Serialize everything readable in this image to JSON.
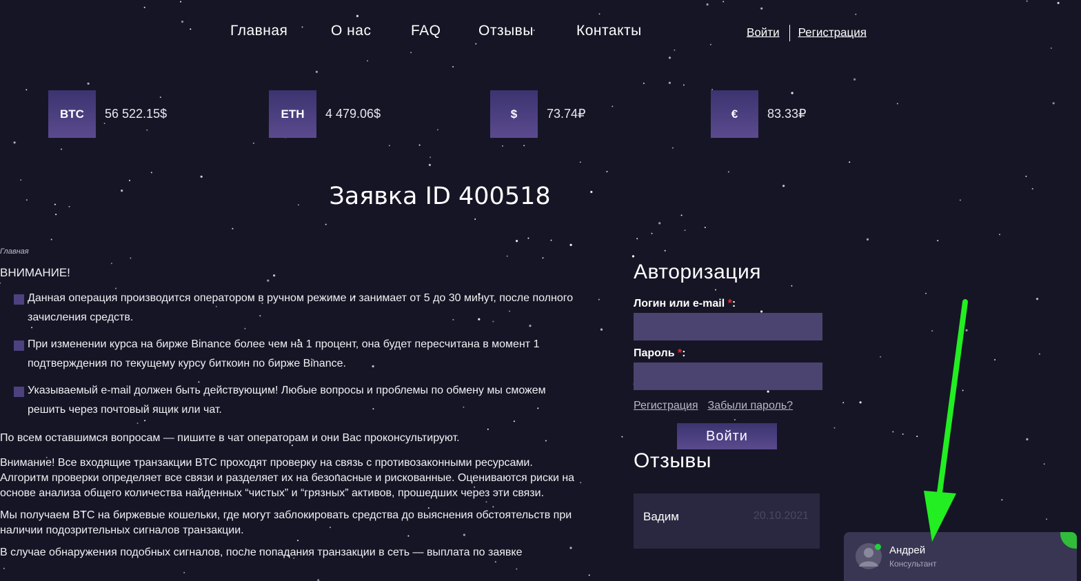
{
  "nav": {
    "items": [
      "Главная",
      "О нас",
      "FAQ",
      "Отзывы",
      "Контакты"
    ],
    "login": "Войти",
    "register": "Регистрация"
  },
  "rates": [
    {
      "symbol": "BTC",
      "value": "56 522.15$"
    },
    {
      "symbol": "ETH",
      "value": "4 479.06$"
    },
    {
      "symbol": "$",
      "value": "73.74₽"
    },
    {
      "symbol": "€",
      "value": "83.33₽"
    }
  ],
  "page": {
    "title": "Заявка ID 400518",
    "breadcrumb": "Главная"
  },
  "content": {
    "warning_title": "ВНИМАНИЕ!",
    "bullets": [
      "Данная операция производится оператором в ручном режиме и занимает от 5 до 30 минут, после полного зачисления средств.",
      "При изменении курса на бирже Binance более чем на 1 процент, она будет пересчитана в момент 1 подтверждения по текущему курсу биткоин по бирже Binance.",
      "Указываемый e-mail должен быть действующим! Любые вопросы и проблемы по обмену мы сможем решить через почтовый ящик или чат."
    ],
    "paragraphs": [
      "По всем оставшимся вопросам — пишите в чат операторам и они Вас проконсультируют.",
      "Внимание! Все входящие транзакции BTC проходят проверку на связь с противозаконными ресурсами. Алгоритм проверки определяет все связи и разделяет их на безопасные и рискованные. Оцениваются риски на основе анализа общего количества найденных “чистых” и “грязных” активов, прошедших через эти связи.",
      "Мы получаем BTC на биржевые кошельки, где могут заблокировать средства до выяснения обстоятельств при наличии подозрительных сигналов транзакции.",
      "В случае обнаружения подобных сигналов, после попадания транзакции в сеть — выплата по заявке"
    ]
  },
  "auth": {
    "title": "Авторизация",
    "login_label": "Логин или e-mail",
    "password_label": "Пароль",
    "required_mark": "*",
    "register_link": "Регистрация",
    "forgot_link": "Забыли пароль?",
    "submit": "Войти"
  },
  "reviews": {
    "title": "Отзывы",
    "items": [
      {
        "name": "Вадим",
        "date": "20.10.2021"
      }
    ]
  },
  "chat": {
    "name": "Андрей",
    "role": "Консультант",
    "online_color": "#1fd23a"
  },
  "colors": {
    "background": "#161525",
    "accent": "#4d4180",
    "annotation_arrow": "#22ee22"
  }
}
